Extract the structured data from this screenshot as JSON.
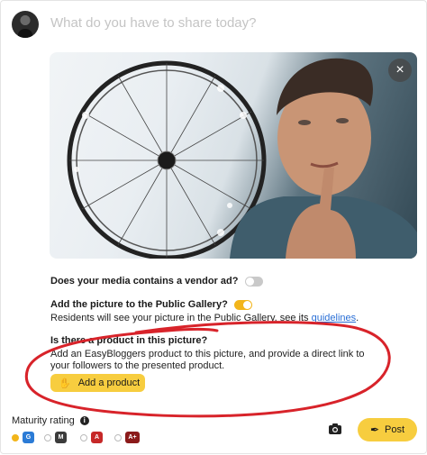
{
  "composer": {
    "placeholder": "What do you have to share today?"
  },
  "media": {
    "close_icon": "×"
  },
  "vendor_ad": {
    "question": "Does your media contains a vendor ad?",
    "enabled": false
  },
  "public_gallery": {
    "question": "Add the picture to the Public Gallery?",
    "enabled": true,
    "description_prefix": "Residents will see your picture in the Public Gallery, see its ",
    "link_text": "guidelines",
    "description_suffix": "."
  },
  "product": {
    "question": "Is there a product in this picture?",
    "description": "Add an EasyBloggers product to this picture, and provide a direct link to your followers to the presented product.",
    "button_label": "Add a product",
    "button_icon": "hand-coin-icon"
  },
  "maturity": {
    "label": "Maturity rating",
    "info_icon": "i",
    "options": [
      {
        "code": "G",
        "color": "#2b7bd6",
        "selected": true
      },
      {
        "code": "M",
        "color": "#3b3b3b",
        "selected": false
      },
      {
        "code": "A",
        "color": "#c62828",
        "selected": false
      },
      {
        "code": "A+",
        "color": "#8b1a1a",
        "selected": false
      }
    ]
  },
  "actions": {
    "camera_icon": "camera-icon",
    "post_label": "Post",
    "post_icon": "quill-icon"
  },
  "colors": {
    "accent": "#f7cd3f",
    "link": "#2a6fd6",
    "annotation": "#d8232a"
  }
}
